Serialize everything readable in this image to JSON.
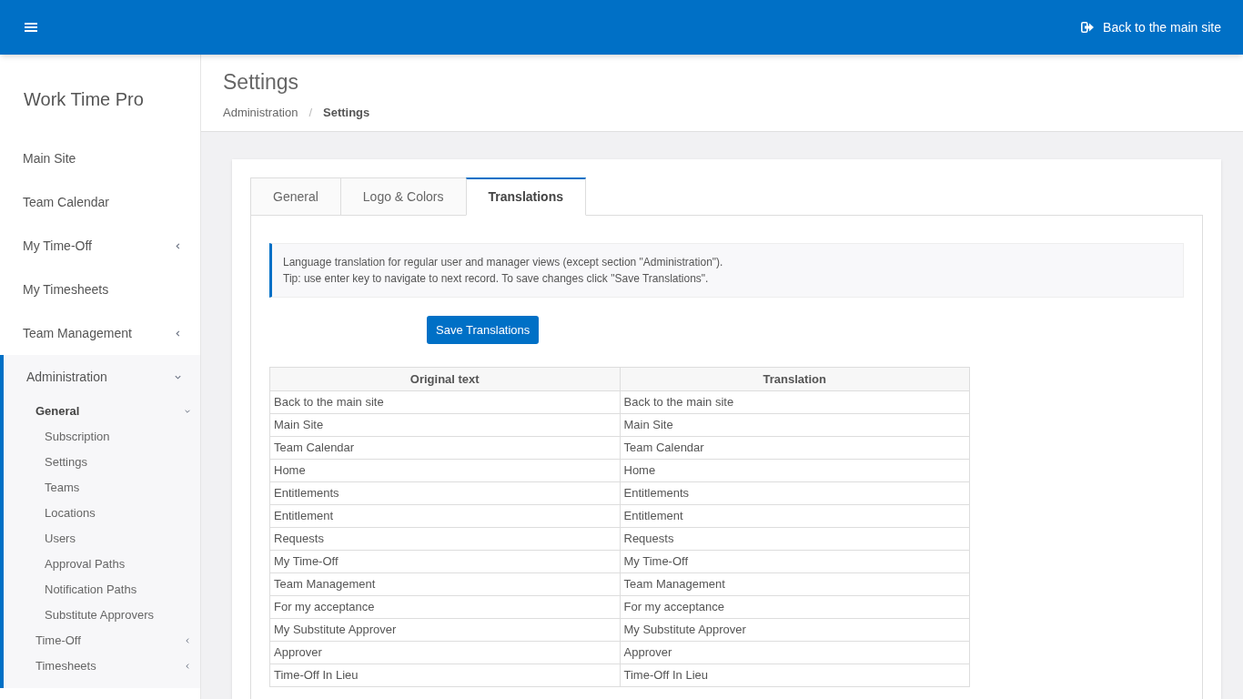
{
  "top_bar": {
    "back_link": "Back to the main site"
  },
  "sidebar": {
    "brand": "Work Time Pro",
    "items": [
      {
        "label": "Main Site"
      },
      {
        "label": "Team Calendar"
      },
      {
        "label": "My Time-Off",
        "expanded": false
      },
      {
        "label": "My Timesheets"
      },
      {
        "label": "Team Management",
        "expanded": false
      },
      {
        "label": "Administration",
        "expanded": true,
        "children": [
          {
            "label": "General",
            "expanded": true,
            "children": [
              {
                "label": "Subscription"
              },
              {
                "label": "Settings"
              },
              {
                "label": "Teams"
              },
              {
                "label": "Locations"
              },
              {
                "label": "Users"
              },
              {
                "label": "Approval Paths"
              },
              {
                "label": "Notification Paths"
              },
              {
                "label": "Substitute Approvers"
              }
            ]
          },
          {
            "label": "Time-Off",
            "expanded": false
          },
          {
            "label": "Timesheets",
            "expanded": false
          }
        ]
      }
    ]
  },
  "page": {
    "title": "Settings",
    "breadcrumb": [
      "Administration",
      "Settings"
    ],
    "breadcrumb_separator": "/"
  },
  "tabs": [
    {
      "label": "General",
      "selected": false
    },
    {
      "label": "Logo & Colors",
      "selected": false
    },
    {
      "label": "Translations",
      "selected": true
    }
  ],
  "notice": [
    "Language translation for regular user and manager views (except section \"Administration\").",
    "Tip: use enter key to navigate to next record. To save changes click \"Save Translations\"."
  ],
  "save_button": "Save Translations",
  "table": {
    "columns": [
      "Original text",
      "Translation"
    ],
    "rows": [
      [
        "Back to the main site",
        "Back to the main site"
      ],
      [
        "Main Site",
        "Main Site"
      ],
      [
        "Team Calendar",
        "Team Calendar"
      ],
      [
        "Home",
        "Home"
      ],
      [
        "Entitlements",
        "Entitlements"
      ],
      [
        "Entitlement",
        "Entitlement"
      ],
      [
        "Requests",
        "Requests"
      ],
      [
        "My Time-Off",
        "My Time-Off"
      ],
      [
        "Team Management",
        "Team Management"
      ],
      [
        "For my acceptance",
        "For my acceptance"
      ],
      [
        "My Substitute Approver",
        "My Substitute Approver"
      ],
      [
        "Approver",
        "Approver"
      ],
      [
        "Time-Off In Lieu",
        "Time-Off In Lieu"
      ]
    ]
  }
}
